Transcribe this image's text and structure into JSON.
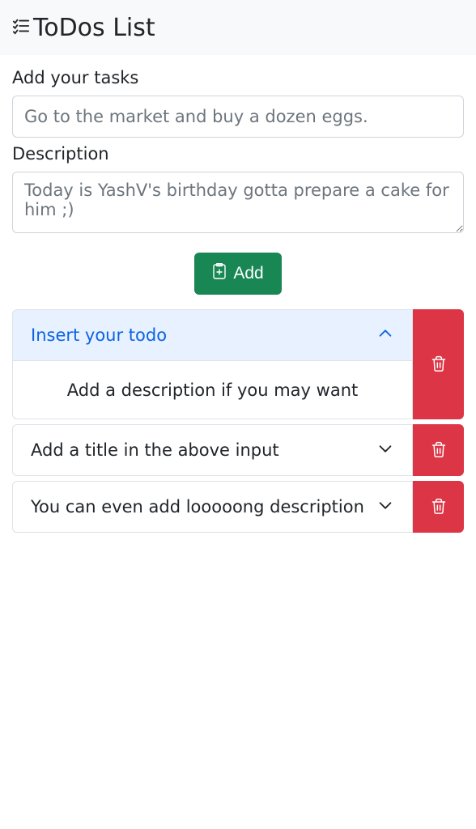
{
  "header": {
    "title": "ToDos List"
  },
  "form": {
    "task_label": "Add your tasks",
    "task_placeholder": "Go to the market and buy a dozen eggs.",
    "task_value": "",
    "desc_label": "Description",
    "desc_placeholder": "Today is YashV's birthday gotta prepare a cake for him ;)",
    "desc_value": "",
    "add_label": "Add"
  },
  "colors": {
    "primary_button": "#198754",
    "danger_button": "#dc3545",
    "accordion_active_bg": "#e7f1ff",
    "accordion_active_text": "#0c63e4"
  },
  "todos": [
    {
      "title": "Insert your todo",
      "description": "Add a description if you may want",
      "expanded": true
    },
    {
      "title": "Add a title in the above input",
      "description": "",
      "expanded": false
    },
    {
      "title": "You can even add looooong description",
      "description": "",
      "expanded": false
    }
  ]
}
